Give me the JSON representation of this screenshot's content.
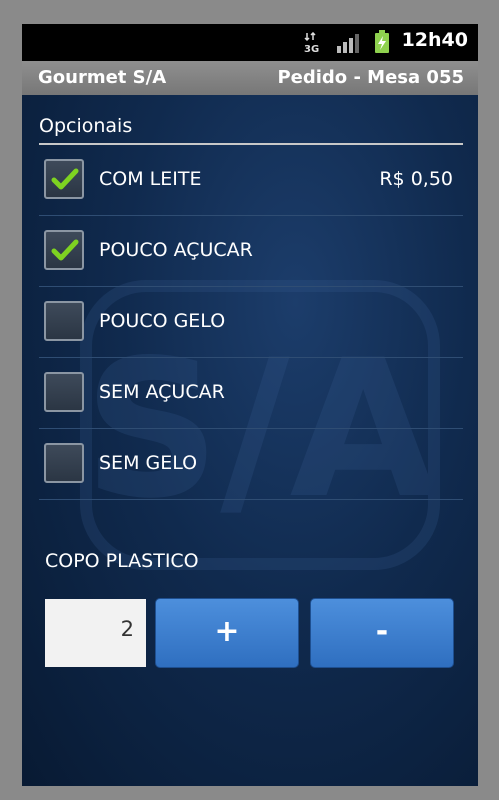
{
  "status_bar": {
    "network": "3G",
    "time": "12h40"
  },
  "title_bar": {
    "app_name": "Gourmet S/A",
    "order_info": "Pedido - Mesa 055"
  },
  "watermark": "S/A",
  "options_section": {
    "title": "Opcionais",
    "items": [
      {
        "label": "COM LEITE",
        "price": "R$ 0,50",
        "checked": true
      },
      {
        "label": "POUCO AÇUCAR",
        "price": "",
        "checked": true
      },
      {
        "label": "POUCO GELO",
        "price": "",
        "checked": false
      },
      {
        "label": "SEM AÇUCAR",
        "price": "",
        "checked": false
      },
      {
        "label": "SEM GELO",
        "price": "",
        "checked": false
      }
    ]
  },
  "cup": {
    "label": "COPO PLASTICO",
    "quantity": "2",
    "plus_label": "+",
    "minus_label": "-"
  },
  "colors": {
    "check_green": "#7ed321",
    "button_blue": "#3b7fd0",
    "background": "#102a4e"
  }
}
